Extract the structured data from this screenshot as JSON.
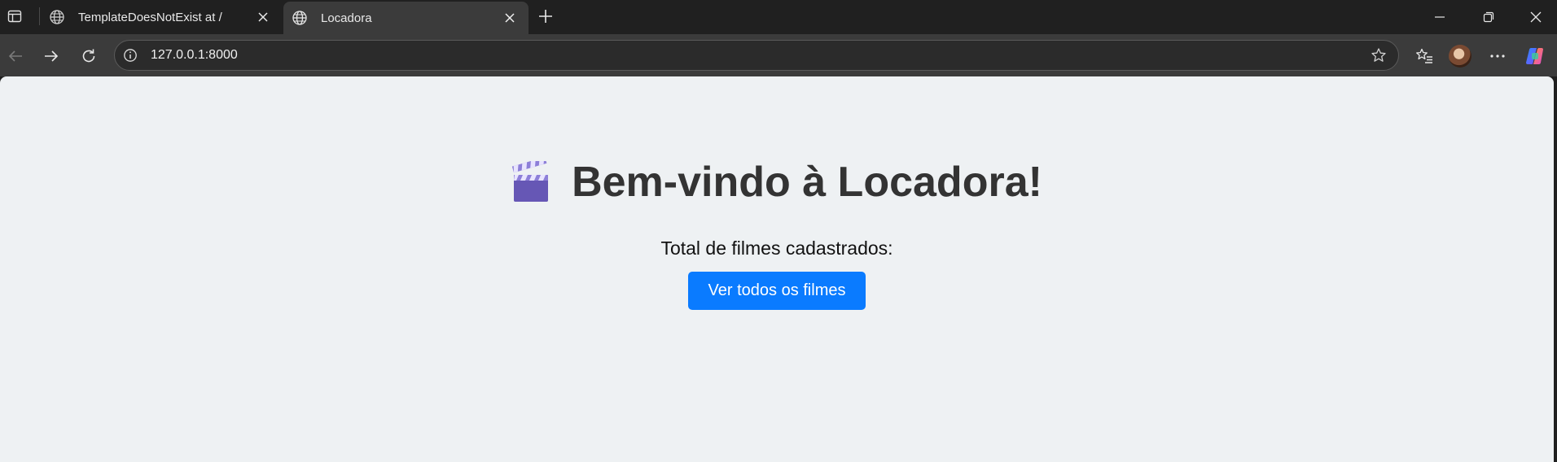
{
  "tabs": [
    {
      "title": "TemplateDoesNotExist at /",
      "icon": "globe-icon",
      "active": false
    },
    {
      "title": "Locadora",
      "icon": "globe-icon",
      "active": true
    }
  ],
  "addressbar": {
    "url": "127.0.0.1:8000"
  },
  "page": {
    "heading": "Bem-vindo à Locadora!",
    "heading_icon": "clapperboard-icon",
    "total_label": "Total de filmes cadastrados:",
    "button_label": "Ver todos os filmes"
  },
  "colors": {
    "page_background": "#eef1f3",
    "button": "#0a7bff",
    "heading_text": "#333333",
    "chrome_dark": "#202020",
    "toolbar": "#3b3b3b"
  }
}
